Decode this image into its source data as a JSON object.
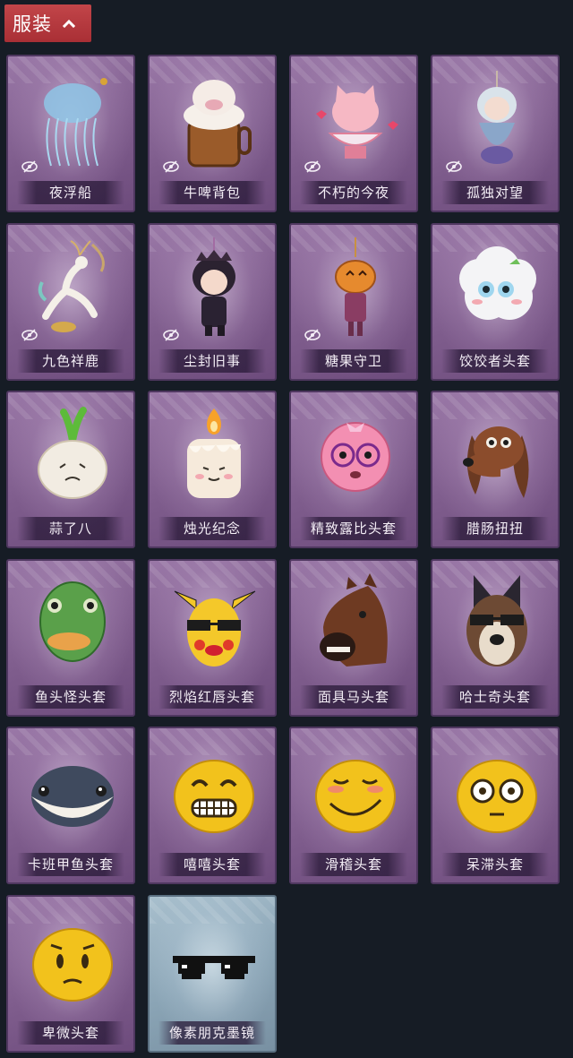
{
  "header": {
    "label": "服装",
    "icon": "chevron-up-icon"
  },
  "items": [
    {
      "name": "夜浮船",
      "hidden": true,
      "icon": "jellyfish-pendant-icon"
    },
    {
      "name": "牛啤背包",
      "hidden": true,
      "icon": "beer-cow-backpack-icon"
    },
    {
      "name": "不朽的今夜",
      "hidden": true,
      "icon": "cat-bowl-pendant-icon"
    },
    {
      "name": "孤独对望",
      "hidden": true,
      "icon": "doll-pendant-icon"
    },
    {
      "name": "九色祥鹿",
      "hidden": true,
      "icon": "deer-pendant-icon"
    },
    {
      "name": "尘封旧事",
      "hidden": true,
      "icon": "chibi-doll-pendant-icon"
    },
    {
      "name": "糖果守卫",
      "hidden": true,
      "icon": "pumpkin-guard-pendant-icon"
    },
    {
      "name": "饺饺者头套",
      "hidden": false,
      "icon": "dumpling-cloud-mask-icon"
    },
    {
      "name": "蒜了八",
      "hidden": false,
      "icon": "garlic-mask-icon"
    },
    {
      "name": "烛光纪念",
      "hidden": false,
      "icon": "candle-mask-icon"
    },
    {
      "name": "精致露比头套",
      "hidden": false,
      "icon": "pink-beaver-mask-icon"
    },
    {
      "name": "腊肠扭扭",
      "hidden": false,
      "icon": "dachshund-mask-icon"
    },
    {
      "name": "鱼头怪头套",
      "hidden": false,
      "icon": "fish-head-mask-icon"
    },
    {
      "name": "烈焰红唇头套",
      "hidden": false,
      "icon": "yellow-mouse-mask-icon"
    },
    {
      "name": "面具马头套",
      "hidden": false,
      "icon": "horse-mask-icon"
    },
    {
      "name": "哈士奇头套",
      "hidden": false,
      "icon": "husky-mask-icon"
    },
    {
      "name": "卡班甲鱼头套",
      "hidden": false,
      "icon": "fish-mask-icon"
    },
    {
      "name": "嘻嘻头套",
      "hidden": false,
      "icon": "grin-emoji-mask-icon"
    },
    {
      "name": "滑稽头套",
      "hidden": false,
      "icon": "funny-emoji-mask-icon"
    },
    {
      "name": "呆滞头套",
      "hidden": false,
      "icon": "dazed-emoji-mask-icon"
    },
    {
      "name": "卑微头套",
      "hidden": false,
      "icon": "humble-emoji-mask-icon"
    },
    {
      "name": "像素朋克墨镜",
      "hidden": false,
      "rare": true,
      "icon": "pixel-sunglasses-icon"
    }
  ]
}
